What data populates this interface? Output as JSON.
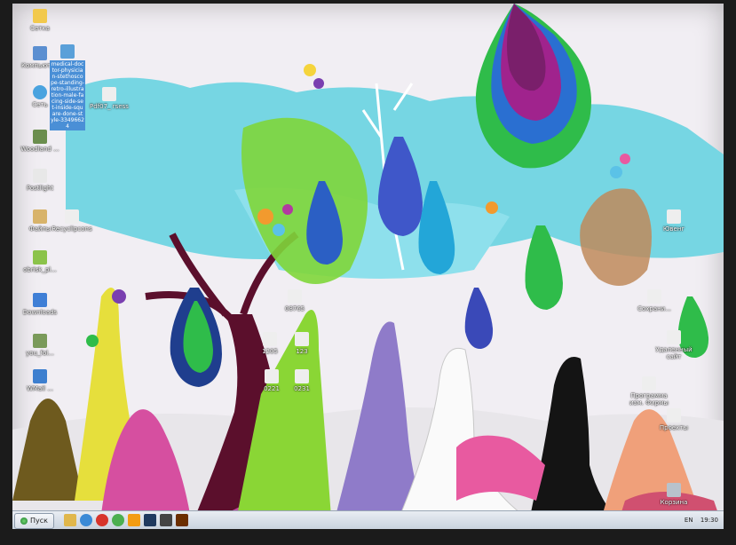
{
  "desktop": {
    "icons": [
      {
        "name": "desktop-icon-setka-1",
        "label": "Сетка",
        "color": "#f2c94c"
      },
      {
        "name": "desktop-icon-computer",
        "label": "Компьютер",
        "color": "#5b8fd1"
      },
      {
        "name": "desktop-icon-network",
        "label": "Сеть",
        "color": "#4aa3df"
      },
      {
        "name": "desktop-icon-woodland",
        "label": "Woodland ...",
        "color": "#6b8e4e"
      },
      {
        "name": "desktop-icon-postlight",
        "label": "Postlight",
        "color": "#e8e8e8"
      },
      {
        "name": "desktop-icon-files",
        "label": "Файлы",
        "color": "#d8b36a"
      },
      {
        "name": "desktop-icon-folder-green",
        "label": "obrisk_pl...",
        "color": "#8bc34a"
      },
      {
        "name": "desktop-icon-downloads",
        "label": "Downloads",
        "color": "#3f7fd6"
      },
      {
        "name": "desktop-icon-you",
        "label": "you_fol...",
        "color": "#7a9a5a"
      },
      {
        "name": "desktop-icon-wmail",
        "label": "WMail ...",
        "color": "#3d7fcf"
      },
      {
        "name": "desktop-icon-recycle-doc",
        "label": "Recyclipcons",
        "color": "#eeeeee"
      },
      {
        "name": "desktop-icon-text-file",
        "label": "Pdf07_ rsess",
        "color": "#eeeeee"
      }
    ],
    "selected_file": {
      "label": "medical-doctor-physician-stethoscope-standing-retro-illustration-male-facing-side-set-inside-square-done-style-33496624",
      "color": "#5aa0d9"
    },
    "right_icons": [
      {
        "name": "desktop-icon-right-1",
        "label": "Ювенг"
      },
      {
        "name": "desktop-icon-right-2",
        "label": "Сохрани..."
      },
      {
        "name": "desktop-icon-right-3",
        "label": "Удаленный сайт"
      },
      {
        "name": "desktop-icon-right-4",
        "label": "Программа изм. Фирмы"
      },
      {
        "name": "desktop-icon-right-5",
        "label": "Проекты"
      },
      {
        "name": "desktop-icon-recycle-bin",
        "label": "Корзина"
      }
    ],
    "middle_icons": [
      {
        "name": "desktop-icon-mid-1",
        "label": "08765"
      },
      {
        "name": "desktop-icon-mid-2",
        "label": "1205"
      },
      {
        "name": "desktop-icon-mid-3",
        "label": "123"
      },
      {
        "name": "desktop-icon-mid-4",
        "label": "0221"
      },
      {
        "name": "desktop-icon-mid-5",
        "label": "0231"
      }
    ]
  },
  "taskbar": {
    "start_label": "Пуск",
    "items": [
      {
        "name": "taskbar-explorer",
        "color": "#e0b74c"
      },
      {
        "name": "taskbar-ie",
        "color": "#3a8ad6"
      },
      {
        "name": "taskbar-opera",
        "color": "#d7342b"
      },
      {
        "name": "taskbar-chrome",
        "color": "#4caf50"
      },
      {
        "name": "taskbar-app-orange",
        "color": "#f39c12"
      },
      {
        "name": "taskbar-app-photoshop",
        "color": "#1f3a5f"
      },
      {
        "name": "taskbar-app-dark",
        "color": "#444444"
      },
      {
        "name": "taskbar-app-illustrator",
        "color": "#6b2e00"
      }
    ],
    "lang": "EN",
    "clock": "19:30"
  }
}
